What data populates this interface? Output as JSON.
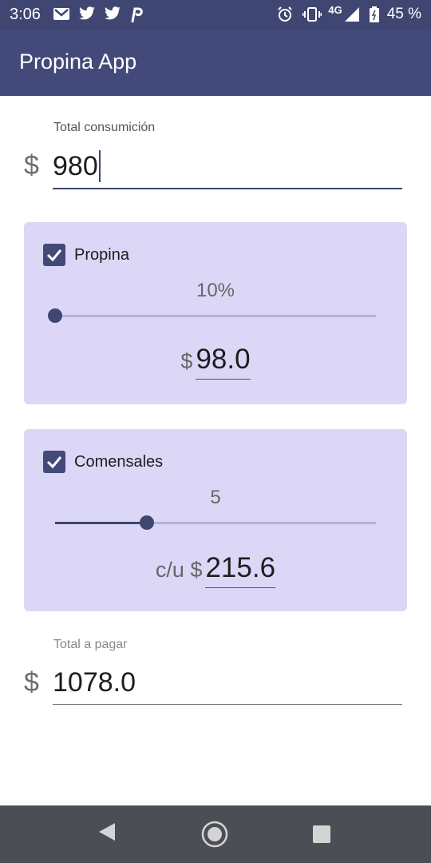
{
  "status_bar": {
    "time": "3:06",
    "network": "4G",
    "battery": "45 %",
    "left_icons": [
      "gmail-icon",
      "twitter-icon",
      "twitter-icon",
      "pinterest-icon"
    ],
    "right_icons": [
      "alarm-icon",
      "vibrate-icon",
      "signal-icon",
      "wifi-icon",
      "battery-icon"
    ]
  },
  "app_bar": {
    "title": "Propina App"
  },
  "consumption": {
    "label": "Total consumición",
    "prefix": "$",
    "value": "980"
  },
  "tip_card": {
    "checkbox_label": "Propina",
    "checked": true,
    "slider_value_text": "10%",
    "slider_fraction": 0.0,
    "result_prefix": "$",
    "result_value": "98.0"
  },
  "diners_card": {
    "checkbox_label": "Comensales",
    "checked": true,
    "slider_value_text": "5",
    "slider_fraction": 0.285,
    "result_prefix": "c/u $",
    "result_value": "215.6"
  },
  "total": {
    "label": "Total a pagar",
    "prefix": "$",
    "value": "1078.0"
  },
  "colors": {
    "primary": "#434a7a",
    "card_bg": "#dcd7f6",
    "nav_bg": "#4b4f55"
  }
}
